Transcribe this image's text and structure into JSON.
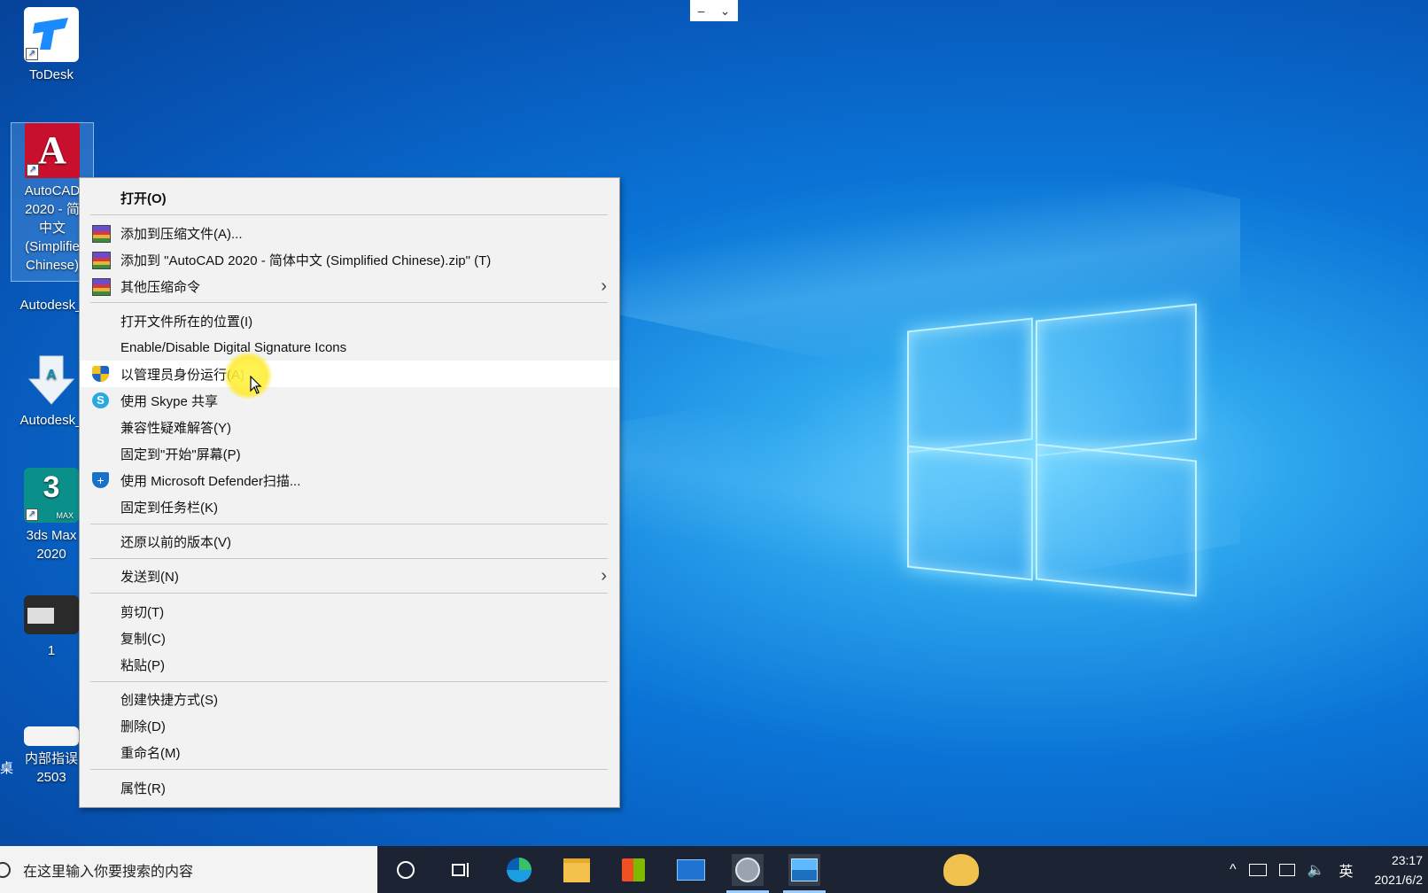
{
  "desktop": {
    "icons": [
      {
        "label": "ToDesk"
      },
      {
        "label": "AutoCAD 2020 - 简体中文 (Simplified Chinese)",
        "label_visible": [
          "AutoCAD",
          "2020 - 简",
          "中文",
          "(Simplifie",
          "Chinese)"
        ]
      },
      {
        "label": "Autodesk_"
      },
      {
        "label": "Autodesk_"
      },
      {
        "label": "3ds Max 2020",
        "lines": [
          "3ds Max",
          "2020"
        ],
        "badge": "3",
        "badge_sub": "MAX"
      },
      {
        "label": "1"
      },
      {
        "label": "内部指误 2503",
        "lines": [
          "内部指误",
          "2503"
        ]
      }
    ],
    "left_edge_text": "桌"
  },
  "top_toolbar": {
    "minimize": "–",
    "expand": "⌄"
  },
  "context_menu": {
    "items": [
      {
        "label": "打开(O)",
        "bold": true
      },
      {
        "label": "添加到压缩文件(A)...",
        "icon": "winrar-icon"
      },
      {
        "label": "添加到 \"AutoCAD 2020 - 简体中文 (Simplified Chinese).zip\" (T)",
        "icon": "winrar-icon"
      },
      {
        "label": "其他压缩命令",
        "icon": "winrar-icon",
        "submenu": true
      },
      {
        "label": "打开文件所在的位置(I)"
      },
      {
        "label": "Enable/Disable Digital Signature Icons"
      },
      {
        "label": "以管理员身份运行(A)",
        "icon": "uac-shield-icon",
        "highlighted": true
      },
      {
        "label": "使用 Skype 共享",
        "icon": "skype-icon"
      },
      {
        "label": "兼容性疑难解答(Y)"
      },
      {
        "label": "固定到\"开始\"屏幕(P)"
      },
      {
        "label": "使用 Microsoft Defender扫描...",
        "icon": "defender-icon"
      },
      {
        "label": "固定到任务栏(K)"
      },
      {
        "label": "还原以前的版本(V)"
      },
      {
        "label": "发送到(N)",
        "submenu": true
      },
      {
        "label": "剪切(T)"
      },
      {
        "label": "复制(C)"
      },
      {
        "label": "粘贴(P)"
      },
      {
        "label": "创建快捷方式(S)"
      },
      {
        "label": "删除(D)"
      },
      {
        "label": "重命名(M)"
      },
      {
        "label": "属性(R)"
      }
    ],
    "submenu_arrow": "›"
  },
  "taskbar": {
    "search_placeholder": "在这里输入你要搜索的内容",
    "apps": [
      "cortana-icon",
      "task-view-icon",
      "edge-icon",
      "file-explorer-icon",
      "store-icon",
      "mail-icon",
      "app-icon",
      "photos-icon",
      "doge-icon"
    ],
    "tray": {
      "chevron": "^",
      "ime": "英"
    },
    "clock": {
      "time": "23:17",
      "date": "2021/6/2"
    }
  }
}
